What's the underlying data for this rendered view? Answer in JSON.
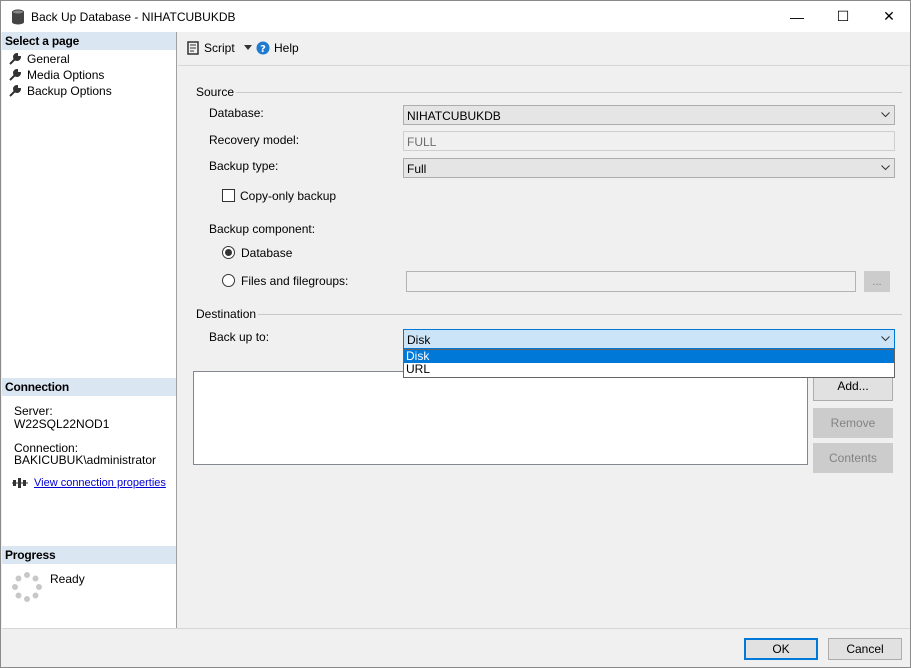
{
  "window": {
    "title": "Back Up Database - NIHATCUBUKDB",
    "minimize_glyph": "—",
    "maximize_glyph": "☐",
    "close_glyph": "✕"
  },
  "left_pane": {
    "select_page_header": "Select a page",
    "pages": [
      {
        "label": "General",
        "icon": "wrench-icon"
      },
      {
        "label": "Media Options",
        "icon": "wrench-icon"
      },
      {
        "label": "Backup Options",
        "icon": "wrench-icon"
      }
    ],
    "connection_header": "Connection",
    "server_label": "Server:",
    "server_value": "W22SQL22NOD1",
    "connection_label": "Connection:",
    "connection_value": "BAKICUBUK\\administrator",
    "view_connection_link": "View connection properties",
    "progress_header": "Progress",
    "progress_status": "Ready"
  },
  "toolbar": {
    "script_label": "Script",
    "help_label": "Help"
  },
  "source": {
    "group_label": "Source",
    "database_label": "Database:",
    "database_value": "NIHATCUBUKDB",
    "recovery_model_label": "Recovery model:",
    "recovery_model_value": "FULL",
    "backup_type_label": "Backup type:",
    "backup_type_value": "Full",
    "copy_only_label": "Copy-only backup",
    "copy_only_checked": false,
    "backup_component_label": "Backup component:",
    "component_database_label": "Database",
    "component_files_label": "Files and filegroups:",
    "component_selected": "Database",
    "browse_button_label": "..."
  },
  "destination": {
    "group_label": "Destination",
    "back_up_to_label": "Back up to:",
    "back_up_to_value": "Disk",
    "dropdown_options": [
      "Disk",
      "URL"
    ],
    "dropdown_highlighted": "Disk",
    "add_button": "Add...",
    "remove_button": "Remove",
    "contents_button": "Contents"
  },
  "footer": {
    "ok_button": "OK",
    "cancel_button": "Cancel"
  },
  "colors": {
    "section_header_bg": "#dbe6f3",
    "selection_blue": "#0078d7",
    "link_blue": "#0000d0"
  }
}
